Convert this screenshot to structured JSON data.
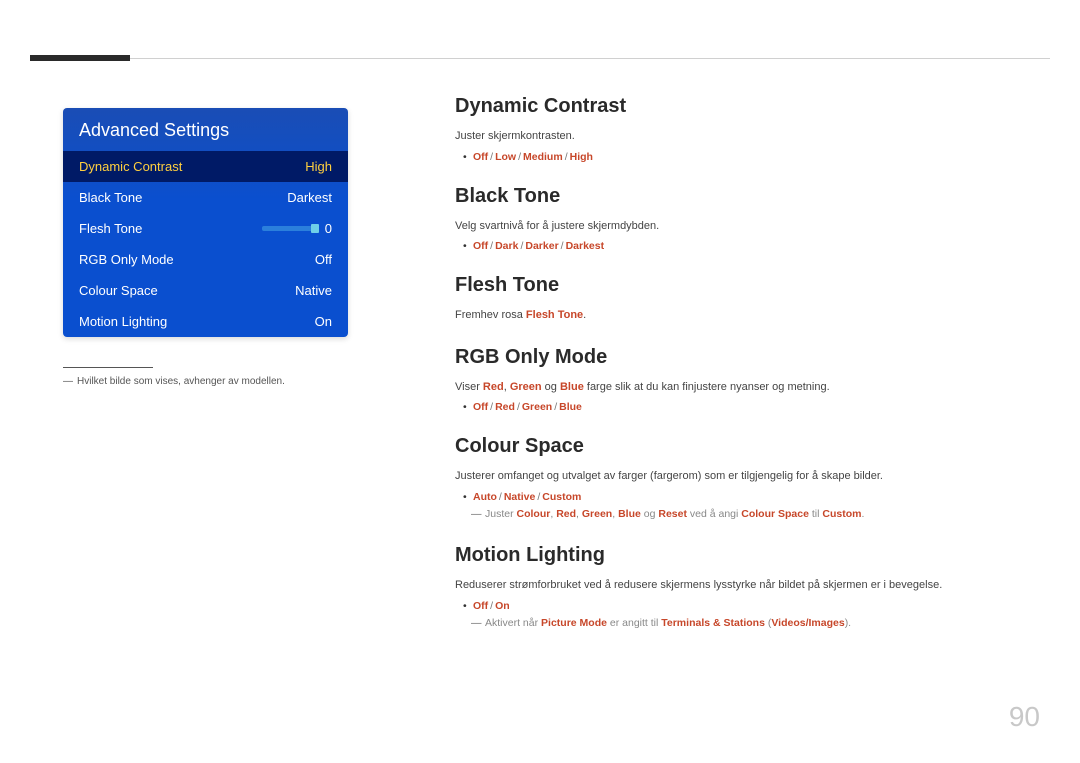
{
  "page_number": "90",
  "panel": {
    "title": "Advanced Settings",
    "rows": [
      {
        "label": "Dynamic Contrast",
        "value": "High",
        "highlight": true
      },
      {
        "label": "Black Tone",
        "value": "Darkest"
      },
      {
        "label": "Flesh Tone",
        "value": "0",
        "slider": true
      },
      {
        "label": "RGB Only Mode",
        "value": "Off"
      },
      {
        "label": "Colour Space",
        "value": "Native"
      },
      {
        "label": "Motion Lighting",
        "value": "On"
      }
    ]
  },
  "footnote": "Hvilket bilde som vises, avhenger av modellen.",
  "sections": {
    "dynamic_contrast": {
      "title": "Dynamic Contrast",
      "desc": "Juster skjermkontrasten.",
      "options": [
        "Off",
        "Low",
        "Medium",
        "High"
      ]
    },
    "black_tone": {
      "title": "Black Tone",
      "desc": "Velg svartnivå for å justere skjermdybden.",
      "options": [
        "Off",
        "Dark",
        "Darker",
        "Darkest"
      ]
    },
    "flesh_tone": {
      "title": "Flesh Tone",
      "desc_prefix": "Fremhev rosa ",
      "desc_bold": "Flesh Tone",
      "desc_suffix": "."
    },
    "rgb_only": {
      "title": "RGB Only Mode",
      "desc_prefix": "Viser ",
      "desc_r": "Red",
      "desc_g": "Green",
      "desc_b": "Blue",
      "desc_middle1": ", ",
      "desc_middle2": " og ",
      "desc_suffix": " farge slik at du kan finjustere nyanser og metning.",
      "options": [
        "Off",
        "Red",
        "Green",
        "Blue"
      ]
    },
    "colour_space": {
      "title": "Colour Space",
      "desc": "Justerer omfanget og utvalget av farger (fargerom) som er tilgjengelig for å skape bilder.",
      "options": [
        "Auto",
        "Native",
        "Custom"
      ],
      "note_prefix": "Juster ",
      "note_words": [
        "Colour",
        "Red",
        "Green",
        "Blue",
        "Reset"
      ],
      "note_join_comma": ", ",
      "note_join_og": " og ",
      "note_mid": " ved å angi ",
      "note_cs": "Colour Space",
      "note_to": " til ",
      "note_custom": "Custom",
      "note_end": "."
    },
    "motion_lighting": {
      "title": "Motion Lighting",
      "desc": "Reduserer strømforbruket ved å redusere skjermens lysstyrke når bildet på skjermen er i bevegelse.",
      "options": [
        "Off",
        "On"
      ],
      "note_prefix": "Aktivert når ",
      "note_pm": "Picture Mode",
      "note_mid": " er angitt til ",
      "note_ts": "Terminals & Stations",
      "note_paren_open": " (",
      "note_vi": "Videos/Images",
      "note_paren_close": ")."
    }
  }
}
